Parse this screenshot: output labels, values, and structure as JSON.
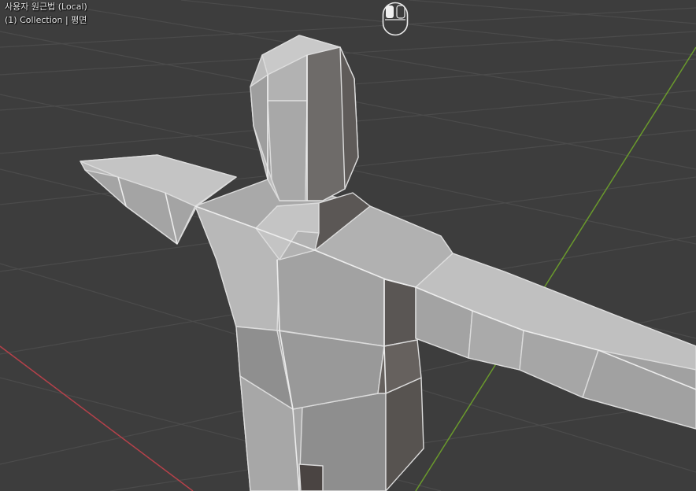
{
  "viewport": {
    "view_label": "사용자 원근법 (Local)",
    "collection_label": "(1) Collection | 평면"
  },
  "icons": {
    "mouse_indicator": "mouse-left-button-icon"
  },
  "colors": {
    "background": "#3d3d3d",
    "grid_line": "#4a4a4a",
    "x_axis": "#b5414a",
    "y_axis": "#6a9a2c",
    "mesh_light": "#b3b3b3",
    "mesh_mid": "#969696",
    "mesh_dark": "#595756",
    "edge_highlight": "#e8e8e8"
  }
}
